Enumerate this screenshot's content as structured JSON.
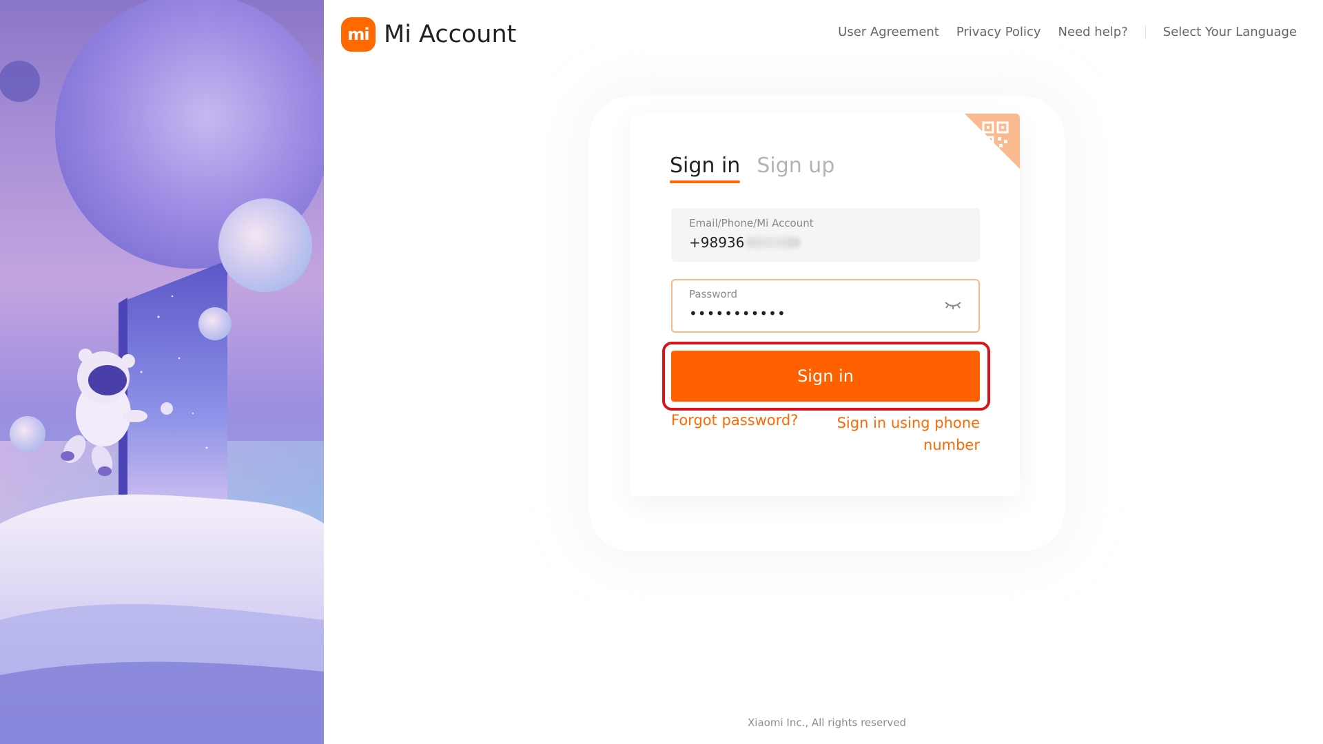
{
  "header": {
    "logo_text": "mi",
    "title": "Mi Account",
    "nav": {
      "user_agreement": "User Agreement",
      "privacy_policy": "Privacy Policy",
      "need_help": "Need help?",
      "select_language": "Select Your Language"
    }
  },
  "login": {
    "tabs": {
      "sign_in": "Sign in",
      "sign_up": "Sign up"
    },
    "account_field": {
      "label": "Email/Phone/Mi Account",
      "value_visible": "+98936"
    },
    "password_field": {
      "label": "Password",
      "value": "•••••••••••"
    },
    "sign_in_button": "Sign in",
    "forgot_password": "Forgot password?",
    "phone_sign_in": "Sign in using phone number"
  },
  "footer": {
    "copyright": "Xiaomi Inc., All rights reserved"
  },
  "colors": {
    "accent": "#ff6900",
    "button": "#ff6000",
    "highlight_border": "#d7141a"
  },
  "icons": {
    "logo": "mi-logo-icon",
    "qr": "qr-code-icon",
    "eye": "eye-closed-icon"
  }
}
